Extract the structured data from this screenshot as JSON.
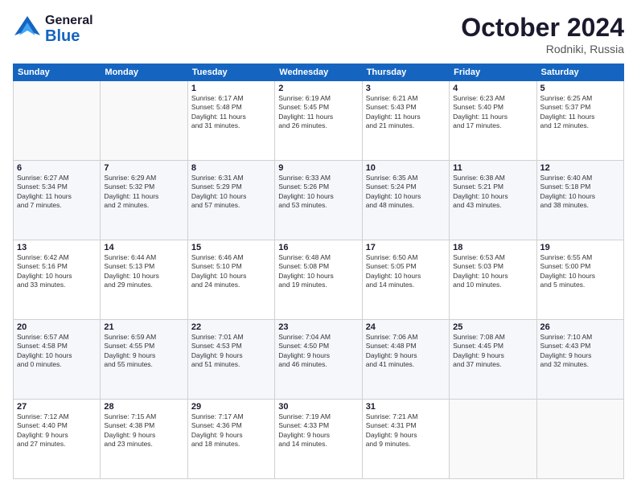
{
  "header": {
    "logo_general": "General",
    "logo_blue": "Blue",
    "month_year": "October 2024",
    "location": "Rodniki, Russia"
  },
  "weekdays": [
    "Sunday",
    "Monday",
    "Tuesday",
    "Wednesday",
    "Thursday",
    "Friday",
    "Saturday"
  ],
  "weeks": [
    [
      {
        "day": "",
        "info": ""
      },
      {
        "day": "",
        "info": ""
      },
      {
        "day": "1",
        "info": "Sunrise: 6:17 AM\nSunset: 5:48 PM\nDaylight: 11 hours\nand 31 minutes."
      },
      {
        "day": "2",
        "info": "Sunrise: 6:19 AM\nSunset: 5:45 PM\nDaylight: 11 hours\nand 26 minutes."
      },
      {
        "day": "3",
        "info": "Sunrise: 6:21 AM\nSunset: 5:43 PM\nDaylight: 11 hours\nand 21 minutes."
      },
      {
        "day": "4",
        "info": "Sunrise: 6:23 AM\nSunset: 5:40 PM\nDaylight: 11 hours\nand 17 minutes."
      },
      {
        "day": "5",
        "info": "Sunrise: 6:25 AM\nSunset: 5:37 PM\nDaylight: 11 hours\nand 12 minutes."
      }
    ],
    [
      {
        "day": "6",
        "info": "Sunrise: 6:27 AM\nSunset: 5:34 PM\nDaylight: 11 hours\nand 7 minutes."
      },
      {
        "day": "7",
        "info": "Sunrise: 6:29 AM\nSunset: 5:32 PM\nDaylight: 11 hours\nand 2 minutes."
      },
      {
        "day": "8",
        "info": "Sunrise: 6:31 AM\nSunset: 5:29 PM\nDaylight: 10 hours\nand 57 minutes."
      },
      {
        "day": "9",
        "info": "Sunrise: 6:33 AM\nSunset: 5:26 PM\nDaylight: 10 hours\nand 53 minutes."
      },
      {
        "day": "10",
        "info": "Sunrise: 6:35 AM\nSunset: 5:24 PM\nDaylight: 10 hours\nand 48 minutes."
      },
      {
        "day": "11",
        "info": "Sunrise: 6:38 AM\nSunset: 5:21 PM\nDaylight: 10 hours\nand 43 minutes."
      },
      {
        "day": "12",
        "info": "Sunrise: 6:40 AM\nSunset: 5:18 PM\nDaylight: 10 hours\nand 38 minutes."
      }
    ],
    [
      {
        "day": "13",
        "info": "Sunrise: 6:42 AM\nSunset: 5:16 PM\nDaylight: 10 hours\nand 33 minutes."
      },
      {
        "day": "14",
        "info": "Sunrise: 6:44 AM\nSunset: 5:13 PM\nDaylight: 10 hours\nand 29 minutes."
      },
      {
        "day": "15",
        "info": "Sunrise: 6:46 AM\nSunset: 5:10 PM\nDaylight: 10 hours\nand 24 minutes."
      },
      {
        "day": "16",
        "info": "Sunrise: 6:48 AM\nSunset: 5:08 PM\nDaylight: 10 hours\nand 19 minutes."
      },
      {
        "day": "17",
        "info": "Sunrise: 6:50 AM\nSunset: 5:05 PM\nDaylight: 10 hours\nand 14 minutes."
      },
      {
        "day": "18",
        "info": "Sunrise: 6:53 AM\nSunset: 5:03 PM\nDaylight: 10 hours\nand 10 minutes."
      },
      {
        "day": "19",
        "info": "Sunrise: 6:55 AM\nSunset: 5:00 PM\nDaylight: 10 hours\nand 5 minutes."
      }
    ],
    [
      {
        "day": "20",
        "info": "Sunrise: 6:57 AM\nSunset: 4:58 PM\nDaylight: 10 hours\nand 0 minutes."
      },
      {
        "day": "21",
        "info": "Sunrise: 6:59 AM\nSunset: 4:55 PM\nDaylight: 9 hours\nand 55 minutes."
      },
      {
        "day": "22",
        "info": "Sunrise: 7:01 AM\nSunset: 4:53 PM\nDaylight: 9 hours\nand 51 minutes."
      },
      {
        "day": "23",
        "info": "Sunrise: 7:04 AM\nSunset: 4:50 PM\nDaylight: 9 hours\nand 46 minutes."
      },
      {
        "day": "24",
        "info": "Sunrise: 7:06 AM\nSunset: 4:48 PM\nDaylight: 9 hours\nand 41 minutes."
      },
      {
        "day": "25",
        "info": "Sunrise: 7:08 AM\nSunset: 4:45 PM\nDaylight: 9 hours\nand 37 minutes."
      },
      {
        "day": "26",
        "info": "Sunrise: 7:10 AM\nSunset: 4:43 PM\nDaylight: 9 hours\nand 32 minutes."
      }
    ],
    [
      {
        "day": "27",
        "info": "Sunrise: 7:12 AM\nSunset: 4:40 PM\nDaylight: 9 hours\nand 27 minutes."
      },
      {
        "day": "28",
        "info": "Sunrise: 7:15 AM\nSunset: 4:38 PM\nDaylight: 9 hours\nand 23 minutes."
      },
      {
        "day": "29",
        "info": "Sunrise: 7:17 AM\nSunset: 4:36 PM\nDaylight: 9 hours\nand 18 minutes."
      },
      {
        "day": "30",
        "info": "Sunrise: 7:19 AM\nSunset: 4:33 PM\nDaylight: 9 hours\nand 14 minutes."
      },
      {
        "day": "31",
        "info": "Sunrise: 7:21 AM\nSunset: 4:31 PM\nDaylight: 9 hours\nand 9 minutes."
      },
      {
        "day": "",
        "info": ""
      },
      {
        "day": "",
        "info": ""
      }
    ]
  ]
}
